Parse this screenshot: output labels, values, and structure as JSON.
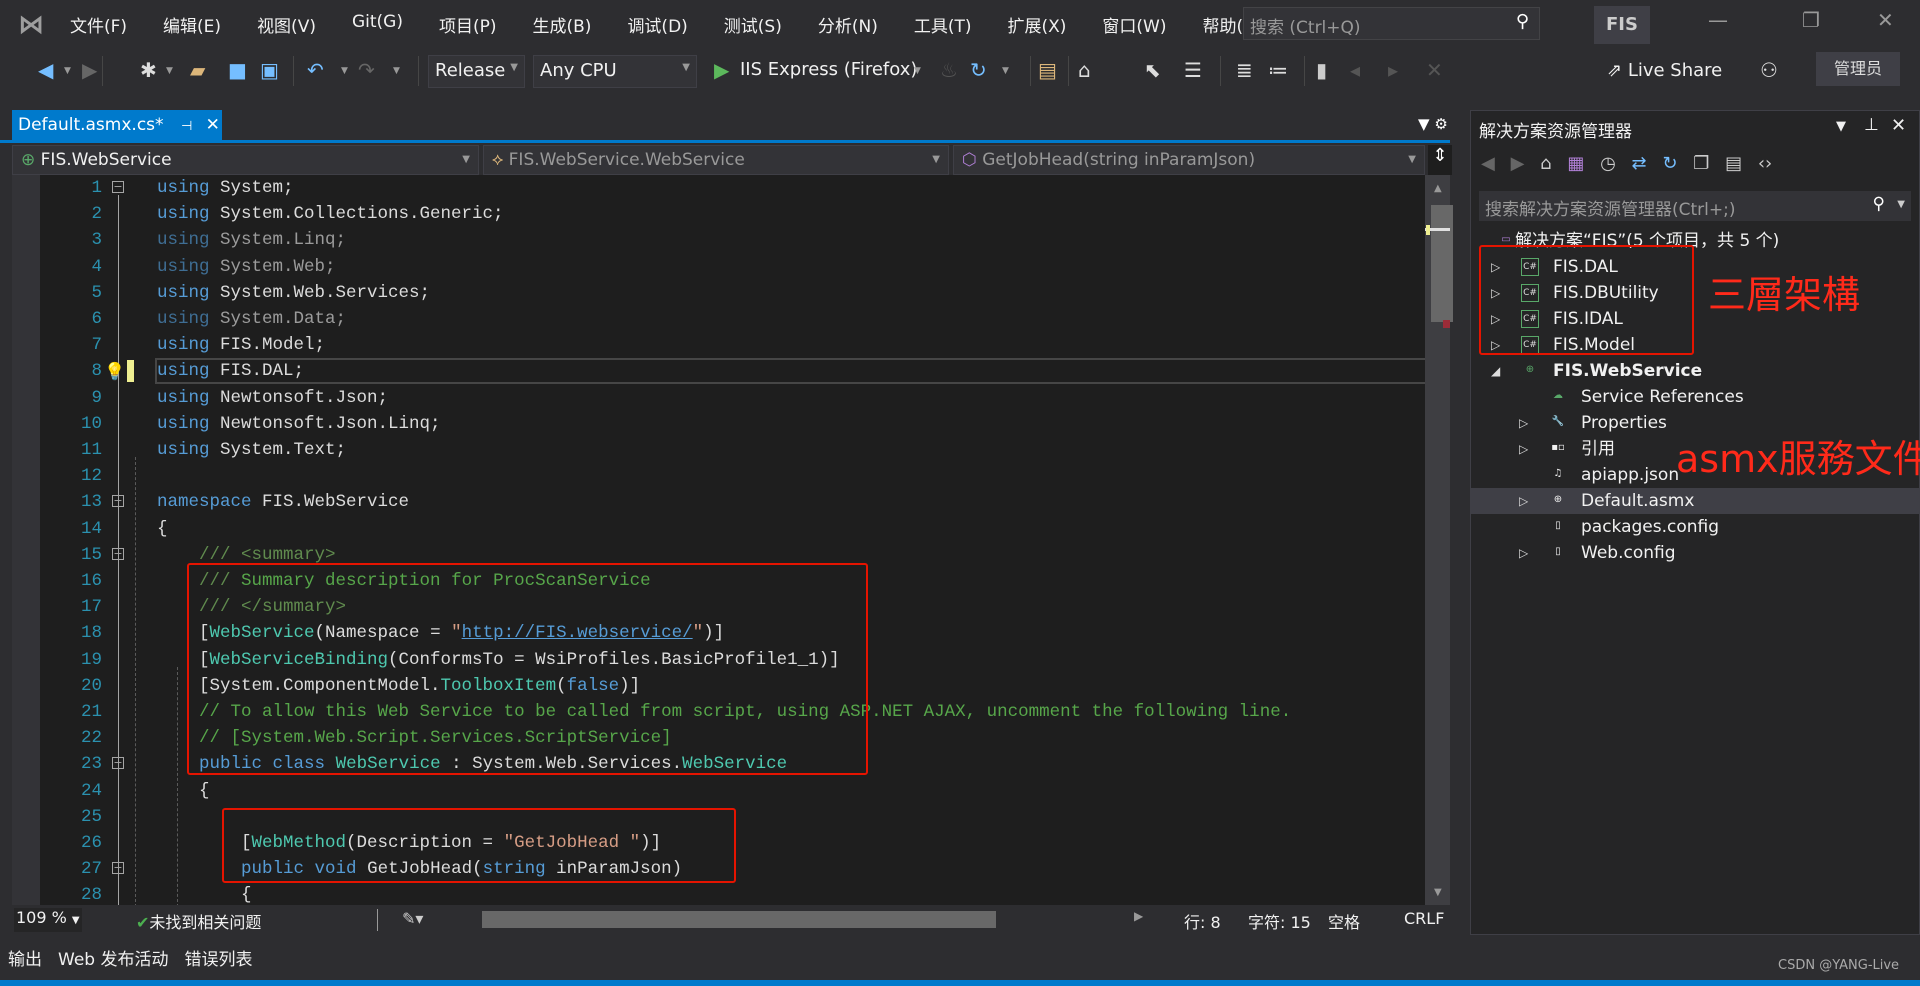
{
  "colors": {
    "accent": "#007acc",
    "keyword": "#569cd6",
    "type": "#4ec9b0",
    "comment": "#57a64a",
    "string": "#d69d85",
    "line_number": "#2b91af",
    "annotation": "#ff2a1a"
  },
  "menu": [
    "文件(F)",
    "编辑(E)",
    "视图(V)",
    "Git(G)",
    "项目(P)",
    "生成(B)",
    "调试(D)",
    "测试(S)",
    "分析(N)",
    "工具(T)",
    "扩展(X)",
    "窗口(W)",
    "帮助(H)"
  ],
  "search": {
    "placeholder": "搜索 (Ctrl+Q)",
    "icon": "search-icon"
  },
  "solution_badge": "FIS",
  "toolbar": {
    "configuration": "Release",
    "platform": "Any CPU",
    "run_target": "IIS Express (Firefox)",
    "live_share": "Live Share",
    "admin": "管理员"
  },
  "editor": {
    "tab": "Default.asmx.cs*",
    "nav": {
      "project": "FIS.WebService",
      "class": "FIS.WebService.WebService",
      "member": "GetJobHead(string inParamJson)"
    },
    "current_line": 8,
    "lines": [
      {
        "n": "1",
        "fold": true,
        "t": [
          [
            "kw",
            "using"
          ],
          [
            "pl",
            " System;"
          ]
        ]
      },
      {
        "n": "2",
        "t": [
          [
            "kw",
            "using"
          ],
          [
            "pl",
            " System.Collections.Generic;"
          ]
        ]
      },
      {
        "n": "3",
        "faded": true,
        "t": [
          [
            "kw",
            "using"
          ],
          [
            "pl",
            " System.Linq;"
          ]
        ]
      },
      {
        "n": "4",
        "faded": true,
        "t": [
          [
            "kw",
            "using"
          ],
          [
            "pl",
            " System.Web;"
          ]
        ]
      },
      {
        "n": "5",
        "t": [
          [
            "kw",
            "using"
          ],
          [
            "pl",
            " System.Web.Services;"
          ]
        ]
      },
      {
        "n": "6",
        "faded": true,
        "t": [
          [
            "kw",
            "using"
          ],
          [
            "pl",
            " System.Data;"
          ]
        ]
      },
      {
        "n": "7",
        "t": [
          [
            "kw",
            "using"
          ],
          [
            "pl",
            " FIS.Model;"
          ]
        ]
      },
      {
        "n": "8",
        "t": [
          [
            "kw",
            "using"
          ],
          [
            "pl",
            " FIS.DAL;"
          ]
        ]
      },
      {
        "n": "9",
        "t": [
          [
            "kw",
            "using"
          ],
          [
            "pl",
            " Newtonsoft.Json;"
          ]
        ]
      },
      {
        "n": "10",
        "t": [
          [
            "kw",
            "using"
          ],
          [
            "pl",
            " Newtonsoft.Json.Linq;"
          ]
        ]
      },
      {
        "n": "11",
        "t": [
          [
            "kw",
            "using"
          ],
          [
            "pl",
            " System.Text;"
          ]
        ]
      },
      {
        "n": "12",
        "t": []
      },
      {
        "n": "13",
        "fold": true,
        "t": [
          [
            "kw",
            "namespace"
          ],
          [
            "pl",
            " FIS.WebService"
          ]
        ]
      },
      {
        "n": "14",
        "t": [
          [
            "pl",
            "{"
          ]
        ]
      },
      {
        "n": "15",
        "fold": true,
        "t": [
          [
            "pl",
            "    "
          ],
          [
            "dc",
            "/// <summary>"
          ]
        ]
      },
      {
        "n": "16",
        "t": [
          [
            "pl",
            "    "
          ],
          [
            "dc",
            "/// "
          ],
          [
            "cm",
            "Summary description for ProcScanService"
          ]
        ]
      },
      {
        "n": "17",
        "t": [
          [
            "pl",
            "    "
          ],
          [
            "dc",
            "/// </summary>"
          ]
        ]
      },
      {
        "n": "18",
        "t": [
          [
            "pl",
            "    ["
          ],
          [
            "ty",
            "WebService"
          ],
          [
            "pl",
            "(Namespace = "
          ],
          [
            "st",
            "\""
          ],
          [
            "lk",
            "http://FIS.webservice/"
          ],
          [
            "st",
            "\""
          ],
          [
            "pl",
            ")]"
          ]
        ]
      },
      {
        "n": "19",
        "t": [
          [
            "pl",
            "    ["
          ],
          [
            "ty",
            "WebServiceBinding"
          ],
          [
            "pl",
            "(ConformsTo = WsiProfiles.BasicProfile1_1)]"
          ]
        ]
      },
      {
        "n": "20",
        "t": [
          [
            "pl",
            "    [System.ComponentModel."
          ],
          [
            "ty",
            "ToolboxItem"
          ],
          [
            "pl",
            "("
          ],
          [
            "kw",
            "false"
          ],
          [
            "pl",
            ")]"
          ]
        ]
      },
      {
        "n": "21",
        "t": [
          [
            "pl",
            "    "
          ],
          [
            "cm",
            "// To allow this Web Service to be called from script, using ASP.NET AJAX, uncomment the following line."
          ]
        ]
      },
      {
        "n": "22",
        "t": [
          [
            "pl",
            "    "
          ],
          [
            "cm",
            "// [System.Web.Script.Services.ScriptService]"
          ]
        ]
      },
      {
        "n": "23",
        "fold": true,
        "t": [
          [
            "pl",
            "    "
          ],
          [
            "kw",
            "public"
          ],
          [
            "pl",
            " "
          ],
          [
            "kw",
            "class"
          ],
          [
            "pl",
            " "
          ],
          [
            "ty",
            "WebService"
          ],
          [
            "pl",
            " : System.Web.Services."
          ],
          [
            "ty",
            "WebService"
          ]
        ]
      },
      {
        "n": "24",
        "t": [
          [
            "pl",
            "    {"
          ]
        ]
      },
      {
        "n": "25",
        "t": []
      },
      {
        "n": "26",
        "t": [
          [
            "pl",
            "        ["
          ],
          [
            "ty",
            "WebMethod"
          ],
          [
            "pl",
            "(Description = "
          ],
          [
            "st",
            "\"GetJobHead \""
          ],
          [
            "pl",
            ")]"
          ]
        ]
      },
      {
        "n": "27",
        "fold": true,
        "t": [
          [
            "pl",
            "        "
          ],
          [
            "kw",
            "public"
          ],
          [
            "pl",
            " "
          ],
          [
            "kw",
            "void"
          ],
          [
            "pl",
            " GetJobHead("
          ],
          [
            "kw",
            "string"
          ],
          [
            "pl",
            " inParamJson)"
          ]
        ]
      },
      {
        "n": "28",
        "t": [
          [
            "pl",
            "        {"
          ]
        ]
      }
    ]
  },
  "status": {
    "zoom": "109 %",
    "issues": "未找到相关问题",
    "line": "行: 8",
    "char": "字符: 15",
    "indent": "空格",
    "eol": "CRLF"
  },
  "solution_explorer": {
    "title": "解决方案资源管理器",
    "search_placeholder": "搜索解决方案资源管理器(Ctrl+;)",
    "items": [
      {
        "label": "解决方案“FIS”(5 个项目，共 5 个)",
        "level": 0,
        "icon": "solution-icon"
      },
      {
        "label": "FIS.DAL",
        "level": 1,
        "icon": "csharp-project-icon",
        "expander": "collapsed"
      },
      {
        "label": "FIS.DBUtility",
        "level": 1,
        "icon": "csharp-project-icon",
        "expander": "collapsed"
      },
      {
        "label": "FIS.IDAL",
        "level": 1,
        "icon": "csharp-project-icon",
        "expander": "collapsed"
      },
      {
        "label": "FIS.Model",
        "level": 1,
        "icon": "csharp-project-icon",
        "expander": "collapsed"
      },
      {
        "label": "FIS.WebService",
        "level": 1,
        "icon": "web-project-icon",
        "expander": "expanded",
        "bold": true
      },
      {
        "label": "Service References",
        "level": 2,
        "icon": "service-references-icon"
      },
      {
        "label": "Properties",
        "level": 2,
        "icon": "wrench-icon",
        "expander": "collapsed"
      },
      {
        "label": "引用",
        "level": 2,
        "icon": "references-icon",
        "expander": "collapsed"
      },
      {
        "label": "apiapp.json",
        "level": 2,
        "icon": "json-file-icon"
      },
      {
        "label": "Default.asmx",
        "level": 2,
        "icon": "asmx-file-icon",
        "expander": "collapsed",
        "selected": true
      },
      {
        "label": "packages.config",
        "level": 2,
        "icon": "config-file-icon"
      },
      {
        "label": "Web.config",
        "level": 2,
        "icon": "config-file-icon",
        "expander": "collapsed"
      }
    ]
  },
  "annotations": {
    "layers": "三層架構",
    "asmx": "asmx服務文件"
  },
  "bottom_tabs": [
    "输出",
    "Web 发布活动",
    "错误列表"
  ],
  "watermark": "CSDN @YANG-Live"
}
